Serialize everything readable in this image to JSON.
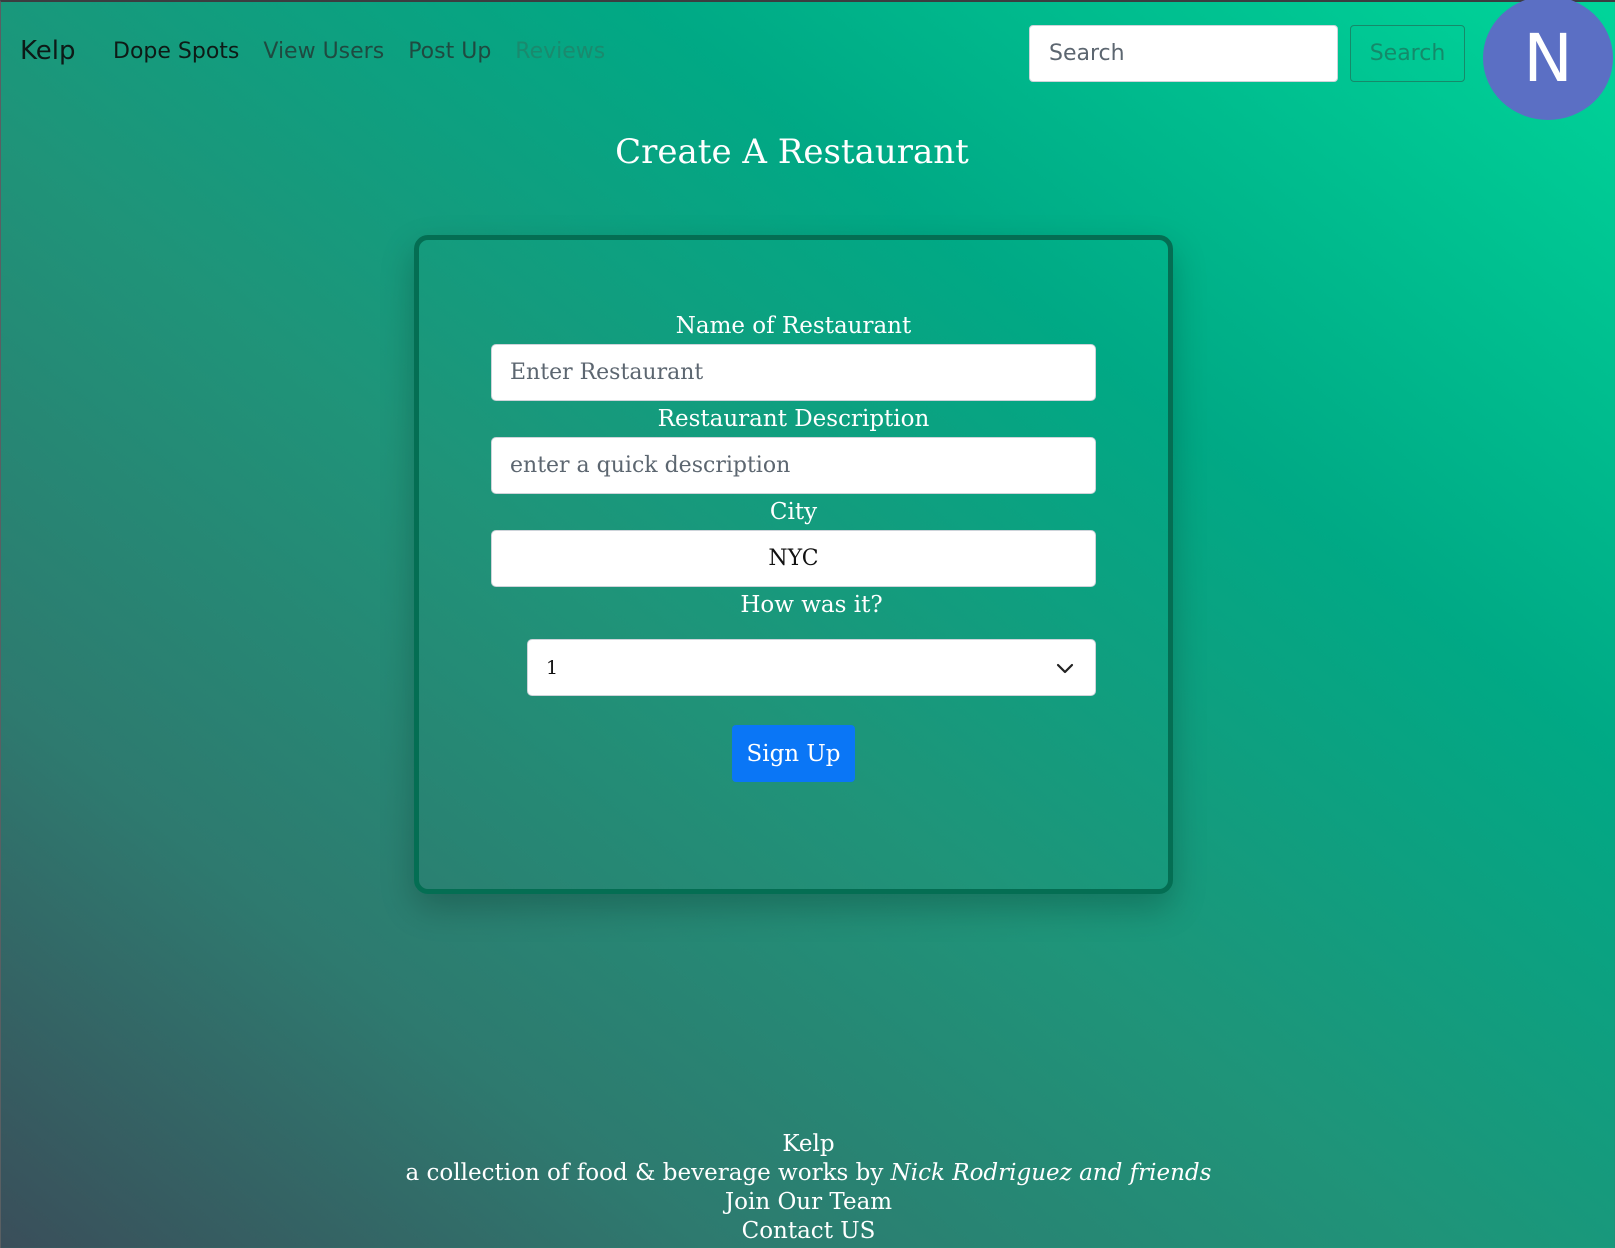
{
  "navbar": {
    "brand": "Kelp",
    "links": [
      {
        "label": "Dope Spots"
      },
      {
        "label": "View Users"
      },
      {
        "label": "Post Up"
      },
      {
        "label": "Reviews"
      }
    ],
    "search_placeholder": "Search",
    "search_button": "Search",
    "avatar_initial": "N"
  },
  "page": {
    "title": "Create A Restaurant"
  },
  "form": {
    "name_label": "Name of Restaurant",
    "name_placeholder": "Enter Restaurant",
    "description_label": "Restaurant Description",
    "description_placeholder": "enter a quick description",
    "city_label": "City",
    "city_value": "NYC",
    "rating_label": "How was it?",
    "rating_value": "1",
    "submit_label": "Sign Up"
  },
  "footer": {
    "brand": "Kelp",
    "tagline_prefix": "a collection of food & beverage works by",
    "tagline_author": "Nick Rodriguez and friends",
    "join_link": "Join Our Team",
    "contact_link": "Contact US"
  },
  "colors": {
    "gradient_start": "#3a4e5a",
    "gradient_end": "#00d59a",
    "card_border": "#046e53",
    "primary_button": "#0a76f6",
    "avatar_bg": "#5b6fc4"
  }
}
